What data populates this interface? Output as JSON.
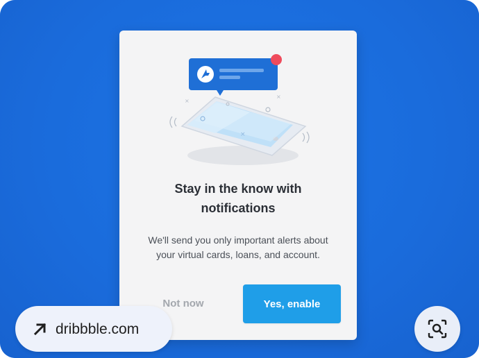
{
  "dialog": {
    "title_line1": "Stay in the know with",
    "title_line2": "notifications",
    "body_line1": "We'll send you only important alerts about",
    "body_line2": "your virtual cards, loans, and account.",
    "secondary_button": "Not now",
    "primary_button": "Yes, enable"
  },
  "illustration": {
    "icons": [
      "bell-notification-bubble",
      "logo-badge-icon",
      "smartphone",
      "notification-dot"
    ],
    "colors": {
      "bubble": "#1f6fd6",
      "dot": "#ef4b5c",
      "phone_screen": "#cfe6f8"
    }
  },
  "overlay": {
    "source_label": "dribbble.com",
    "source_icon": "arrow-up-right-icon",
    "lens_icon": "visual-search-icon"
  },
  "colors": {
    "background": "#1b6fe0",
    "dialog": "#f4f4f5",
    "primary_button": "#1f9ee8",
    "title_text": "#2b2f36"
  }
}
